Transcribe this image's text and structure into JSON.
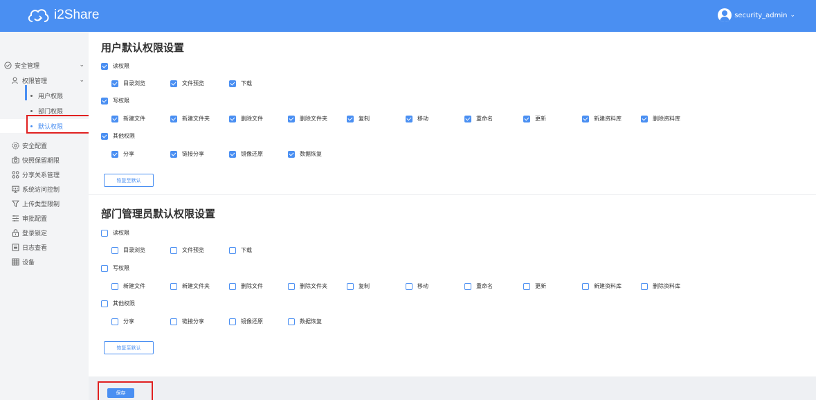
{
  "app": {
    "name": "i2Share"
  },
  "user": {
    "name": "security_admin"
  },
  "sidebar": {
    "security_mgmt": "安全管理",
    "perm_mgmt": "权限管理",
    "sub_items": [
      "用户权限",
      "部门权限",
      "默认权限"
    ],
    "items": [
      "安全配置",
      "快照保留期限",
      "分享关系管理",
      "系统访问控制",
      "上传类型限制",
      "审批配置",
      "登录锁定",
      "日志查看",
      "设备"
    ]
  },
  "user_section": {
    "title": "用户默认权限设置",
    "read": {
      "label": "读权限",
      "checked": true,
      "options": [
        "目录浏览",
        "文件预览",
        "下载"
      ]
    },
    "write": {
      "label": "写权限",
      "checked": true,
      "options": [
        "新建文件",
        "新建文件夹",
        "删除文件",
        "删除文件夹",
        "复制",
        "移动",
        "重命名",
        "更新",
        "新建资料库",
        "删除资料库"
      ]
    },
    "other": {
      "label": "其他权限",
      "checked": true,
      "options": [
        "分享",
        "链接分享",
        "镜像还原",
        "数据恢复"
      ]
    },
    "reset_label": "恢复至默认"
  },
  "dept_section": {
    "title": "部门管理员默认权限设置",
    "read": {
      "label": "读权限",
      "checked": false,
      "options": [
        "目录浏览",
        "文件预览",
        "下载"
      ]
    },
    "write": {
      "label": "写权限",
      "checked": false,
      "options": [
        "新建文件",
        "新建文件夹",
        "删除文件",
        "删除文件夹",
        "复制",
        "移动",
        "重命名",
        "更新",
        "新建资料库",
        "删除资料库"
      ]
    },
    "other": {
      "label": "其他权限",
      "checked": false,
      "options": [
        "分享",
        "链接分享",
        "镜像还原",
        "数据恢复"
      ]
    },
    "reset_label": "恢复至默认"
  },
  "save_label": "保存",
  "colors": {
    "accent": "#4a8ff2",
    "highlight_box": "#e02020"
  }
}
